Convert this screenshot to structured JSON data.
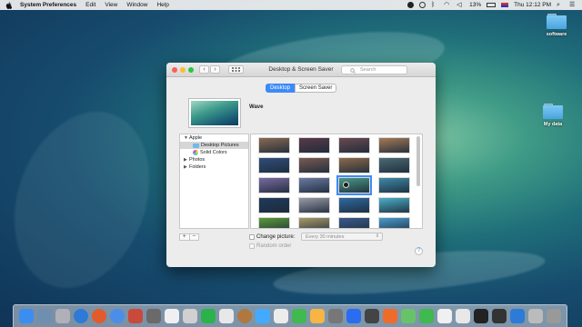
{
  "menubar": {
    "app_name": "System Preferences",
    "items": [
      "Edit",
      "View",
      "Window",
      "Help"
    ],
    "battery": "13%",
    "clock": "Thu 12:12 PM"
  },
  "desktop_icons": [
    {
      "label": "software"
    },
    {
      "label": "My data"
    }
  ],
  "window": {
    "title": "Desktop & Screen Saver",
    "search_placeholder": "Search",
    "tabs": [
      {
        "label": "Desktop",
        "active": true
      },
      {
        "label": "Screen Saver",
        "active": false
      }
    ],
    "current_wallpaper_name": "Wave",
    "sidebar": {
      "items": [
        {
          "label": "Apple",
          "expanded": true
        },
        {
          "label": "Desktop Pictures",
          "selected": true,
          "icon": "folder-icon"
        },
        {
          "label": "Solid Colors",
          "icon": "color-wheel-icon"
        },
        {
          "label": "Photos",
          "expanded": false
        },
        {
          "label": "Folders",
          "expanded": false
        }
      ]
    },
    "plus_label": "+",
    "minus_label": "−",
    "change_picture_label": "Change picture:",
    "change_picture_checked": false,
    "interval_value": "Every 30 minutes",
    "random_order_label": "Random order",
    "random_order_checked": false,
    "help_label": "?"
  },
  "thumbnail_colors": [
    [
      "#8a6a52",
      "#5a3a48",
      "#6b4a50",
      "#a57a58"
    ],
    [
      "#2f4f7a",
      "#7a5a52",
      "#8c6a4a",
      "#4a6a72"
    ],
    [
      "#7a6aa0",
      "#6a7aa0",
      "#4a9a86",
      "#3e8aa8"
    ],
    [
      "#1f3a5a",
      "#9a9aa8",
      "#2e6aa0",
      "#4ab0c8"
    ],
    [
      "#5a9a3a",
      "#a89a68",
      "#3a5a8a",
      "#4a9acc"
    ]
  ]
}
